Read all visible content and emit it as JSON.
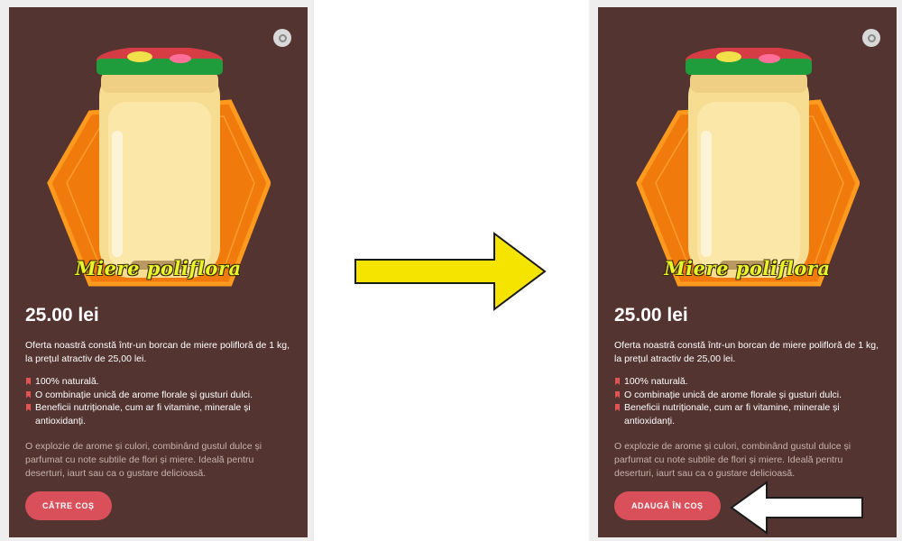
{
  "product": {
    "image_label": "Miere poliflora",
    "price": "25.00 lei",
    "description": "Oferta noastră constă într-un borcan de miere polifloră de 1 kg, la prețul atractiv de 25,00 lei.",
    "features": [
      "100% naturală.",
      "O combinație unică de arome florale și gusturi dulci.",
      "Beneficii nutriționale, cum ar fi vitamine, minerale și antioxidanți."
    ],
    "note": "O explozie de arome și culori, combinând gustul dulce și parfumat cu note subtile de flori și miere. Ideală pentru deserturi, iaurt sau ca o gustare delicioasă."
  },
  "before": {
    "button_label": "CĂTRE COȘ"
  },
  "after": {
    "button_label": "ADAUGĂ ÎN COȘ"
  },
  "icons": {
    "zoom": "zoom-icon",
    "bullet": "bookmark-icon",
    "transition_arrow": "arrow-right-icon",
    "pointer_arrow": "arrow-left-icon"
  },
  "colors": {
    "card_background": "#533431",
    "button": "#d9505a",
    "bullet": "#e25454",
    "note_text": "#c7b2ae",
    "transition_arrow": "#f5e400",
    "label": "#e8f52a"
  }
}
